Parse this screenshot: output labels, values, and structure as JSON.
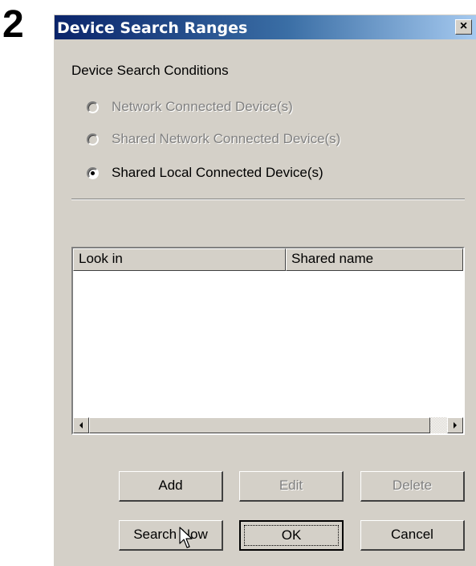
{
  "step_number": "2",
  "dialog": {
    "title": "Device Search Ranges",
    "close_label": "×"
  },
  "conditions": {
    "heading": "Device Search Conditions",
    "options": [
      {
        "label": "Network Connected Device(s)",
        "selected": false,
        "enabled": false
      },
      {
        "label": "Shared Network Connected Device(s)",
        "selected": false,
        "enabled": false
      },
      {
        "label": "Shared Local Connected Device(s)",
        "selected": true,
        "enabled": true
      }
    ]
  },
  "list": {
    "columns": [
      "Look in",
      "Shared name"
    ],
    "rows": []
  },
  "buttons": {
    "add": "Add",
    "edit": "Edit",
    "delete": "Delete",
    "search_now": "Search Now",
    "ok": "OK",
    "cancel": "Cancel"
  },
  "icons": {
    "scroll_left": "arrow-left-icon",
    "scroll_right": "arrow-right-icon",
    "cursor": "mouse-pointer-icon"
  }
}
